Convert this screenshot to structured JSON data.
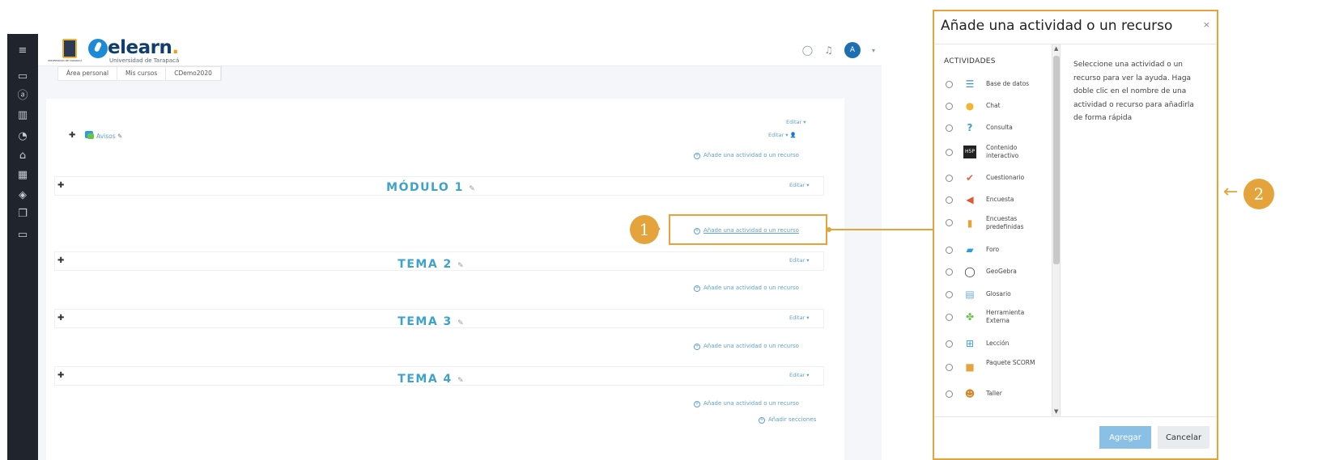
{
  "site": {
    "brand": "elearn",
    "brand_dot": ".",
    "university": "Universidad de Tarapacá",
    "crest_caption": "UNIVERSIDAD DE TARAPACÁ"
  },
  "breadcrumb": [
    "Área personal",
    "Mis cursos",
    "CDemo2020"
  ],
  "user_avatar_initial": "A",
  "course": {
    "avisos_label": "Avisos",
    "edit_label": "Editar ▾",
    "edit_user_label": "Editar ▾ 👤",
    "add_activity_label": "Añade una actividad o un recurso",
    "add_sections_label": "Añadir secciones",
    "sections": [
      {
        "title": "MÓDULO 1"
      },
      {
        "title": "TEMA 2"
      },
      {
        "title": "TEMA 3"
      },
      {
        "title": "TEMA 4"
      }
    ]
  },
  "annotations": {
    "step1": "1",
    "step2": "2",
    "accent": "#e5a33b"
  },
  "dialog": {
    "title": "Añade una actividad o un recurso",
    "close": "×",
    "section_header": "ACTIVIDADES",
    "items": [
      {
        "label": "Base de datos",
        "icon": "database-icon"
      },
      {
        "label": "Chat",
        "icon": "chat-icon"
      },
      {
        "label": "Consulta",
        "icon": "question-icon"
      },
      {
        "label": "Contenido interactivo",
        "icon": "h5p-icon"
      },
      {
        "label": "Cuestionario",
        "icon": "quiz-icon"
      },
      {
        "label": "Encuesta",
        "icon": "survey-icon"
      },
      {
        "label": "Encuestas predefinidas",
        "icon": "chart-icon"
      },
      {
        "label": "Foro",
        "icon": "forum-icon"
      },
      {
        "label": "GeoGebra",
        "icon": "geogebra-icon"
      },
      {
        "label": "Glosario",
        "icon": "glossary-icon"
      },
      {
        "label": "Herramienta Externa",
        "icon": "puzzle-icon"
      },
      {
        "label": "Lección",
        "icon": "lesson-icon"
      },
      {
        "label": "Paquete SCORM",
        "icon": "package-icon"
      },
      {
        "label": "Taller",
        "icon": "workshop-icon"
      }
    ],
    "help_text": "Seleccione una actividad o un recurso para ver la ayuda. Haga doble clic en el nombre de una actividad o recurso para añadirla de forma rápida",
    "add_button": "Agregar",
    "cancel_button": "Cancelar"
  }
}
